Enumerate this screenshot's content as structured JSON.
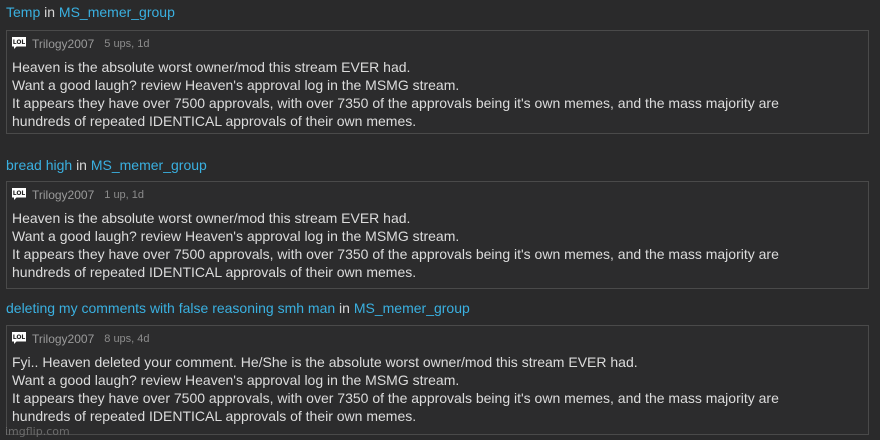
{
  "posts": [
    {
      "title": "Temp",
      "in_word": "in",
      "group": "MS_memer_group",
      "comment": {
        "author": "Trilogy2007",
        "stats": "5 ups, 1d",
        "lines": [
          "Heaven is the absolute worst owner/mod this stream EVER had.",
          "Want a good laugh? review Heaven's approval log in the MSMG stream.",
          "It appears they have over 7500 approvals, with over 7350 of the approvals being it's own memes, and the mass majority are",
          "hundreds of repeated IDENTICAL approvals of their own memes."
        ]
      }
    },
    {
      "title": "bread high",
      "in_word": "in",
      "group": "MS_memer_group",
      "comment": {
        "author": "Trilogy2007",
        "stats": "1 up, 1d",
        "lines": [
          "Heaven is the absolute worst owner/mod this stream EVER had.",
          "Want a good laugh? review Heaven's approval log in the MSMG stream.",
          "It appears they have over 7500 approvals, with over 7350 of the approvals being it's own memes, and the mass majority are",
          "hundreds of repeated IDENTICAL approvals of their own memes."
        ]
      }
    },
    {
      "title": "deleting my comments with false reasoning smh man",
      "in_word": "in",
      "group": "MS_memer_group",
      "comment": {
        "author": "Trilogy2007",
        "stats": "8 ups, 4d",
        "lines": [
          "Fyi.. Heaven deleted your comment. He/She is the absolute worst owner/mod this stream EVER had.",
          "Want a good laugh? review Heaven's approval log in the MSMG stream.",
          "It appears they have over 7500 approvals, with over 7350 of the approvals being it's own memes, and the mass majority are",
          "hundreds of repeated IDENTICAL approvals of their own memes."
        ]
      }
    }
  ],
  "icon": "lol-chat-icon",
  "watermark": "imgflip.com",
  "colors": {
    "background": "#2a2a2b",
    "link": "#3ab0e0",
    "text": "#dcdcdc",
    "meta": "#8c8c8c",
    "border": "#4a4a4a"
  }
}
